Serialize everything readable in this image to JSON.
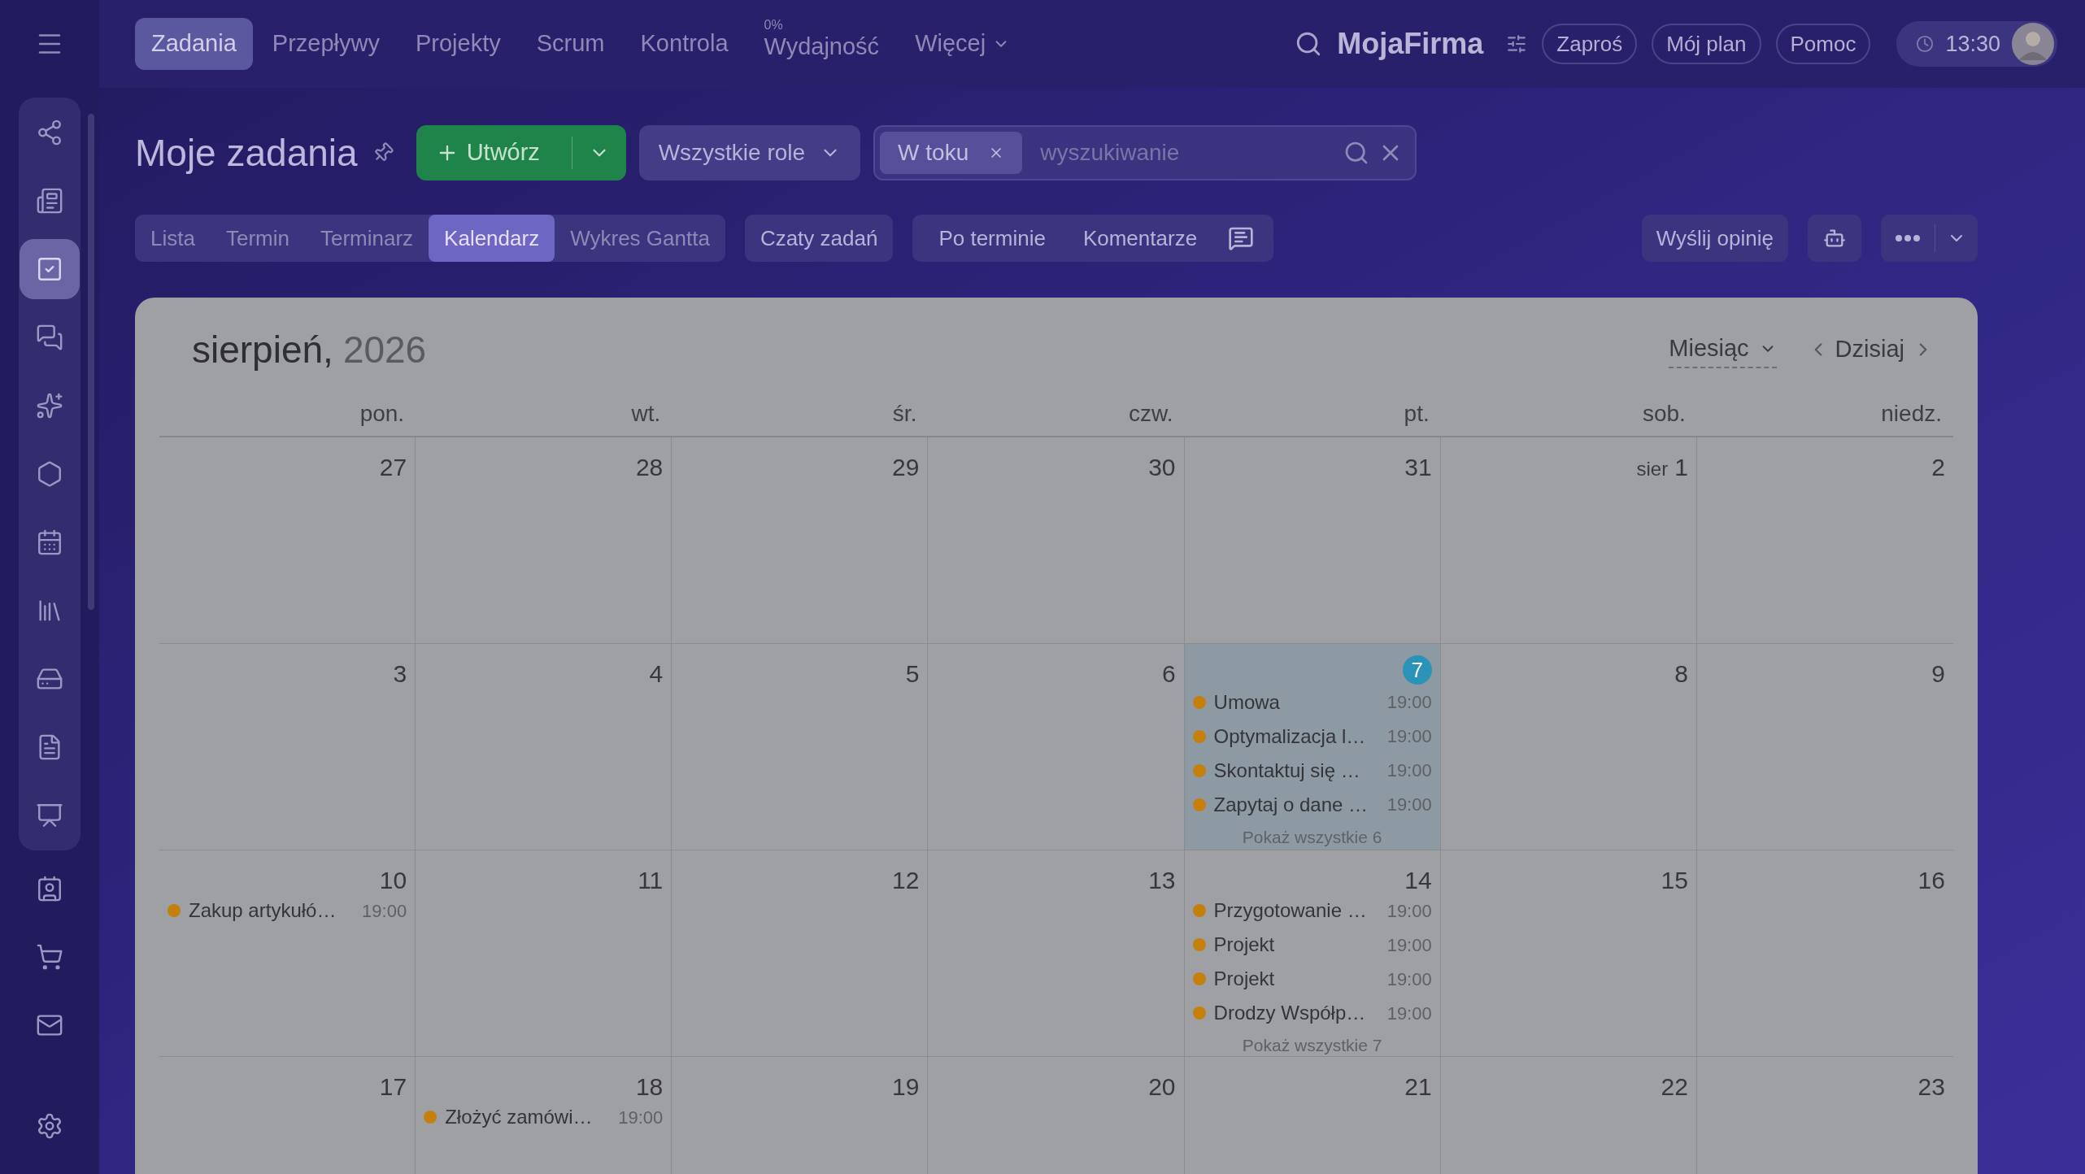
{
  "top_nav": {
    "tabs": [
      {
        "label": "Zadania",
        "selected": true,
        "kind": "link"
      },
      {
        "label": "Przepływy",
        "selected": false,
        "kind": "link"
      },
      {
        "label": "Projekty",
        "selected": false,
        "kind": "link"
      },
      {
        "label": "Scrum",
        "selected": false,
        "kind": "link"
      },
      {
        "label": "Kontrola",
        "selected": false,
        "kind": "link"
      },
      {
        "label": "Wydajność",
        "selected": false,
        "kind": "link",
        "badge": "0%"
      },
      {
        "label": "Więcej",
        "selected": false,
        "kind": "menu"
      }
    ],
    "brand": "MojaFirma",
    "buttons": [
      "Zaproś",
      "Mój plan",
      "Pomoc"
    ],
    "clock": "13:30"
  },
  "sidebar": {
    "pinned_items": [
      {
        "kind": "nodes",
        "selected": false
      },
      {
        "kind": "news",
        "selected": false
      },
      {
        "kind": "tasks",
        "selected": true
      },
      {
        "kind": "chat",
        "selected": false
      },
      {
        "kind": "sparkle",
        "selected": false
      },
      {
        "kind": "hexagon",
        "selected": false
      },
      {
        "kind": "calendar",
        "selected": false
      },
      {
        "kind": "library",
        "selected": false
      },
      {
        "kind": "drive",
        "selected": false
      },
      {
        "kind": "document",
        "selected": false
      },
      {
        "kind": "presentation",
        "selected": false
      }
    ],
    "items": [
      {
        "kind": "contact",
        "selected": false
      },
      {
        "kind": "cart",
        "selected": false
      },
      {
        "kind": "mail",
        "selected": false
      },
      {
        "kind": "settings",
        "selected": false
      }
    ]
  },
  "header": {
    "title": "Moje zadania",
    "create_button": "Utwórz",
    "roles_dropdown": "Wszystkie role",
    "filter_chip": "W toku",
    "search": {
      "placeholder": "wyszukiwanie"
    }
  },
  "view_tabs": [
    {
      "label": "Lista",
      "selected": false
    },
    {
      "label": "Termin",
      "selected": false
    },
    {
      "label": "Terminarz",
      "selected": false
    },
    {
      "label": "Kalendarz",
      "selected": true
    },
    {
      "label": "Wykres Gantta",
      "selected": false
    }
  ],
  "chats_button": "Czaty zadań",
  "filters": [
    "Po terminie",
    "Komentarze"
  ],
  "feedback_button": "Wyślij opinię",
  "calendar": {
    "month": "sierpień,",
    "year": "2026",
    "view": "Miesiąc",
    "today_button": "Dzisiaj",
    "weekdays": [
      "pon.",
      "wt.",
      "śr.",
      "czw.",
      "pt.",
      "sob.",
      "niedz."
    ],
    "weeks": [
      [
        {
          "day": "27",
          "today": false
        },
        {
          "day": "28",
          "today": false
        },
        {
          "day": "29",
          "today": false
        },
        {
          "day": "30",
          "today": false
        },
        {
          "day": "31",
          "today": false
        },
        {
          "day": "1",
          "month_prefix": "sier",
          "today": false
        },
        {
          "day": "2",
          "today": false
        }
      ],
      [
        {
          "day": "3",
          "today": false
        },
        {
          "day": "4",
          "today": false
        },
        {
          "day": "5",
          "today": false
        },
        {
          "day": "6",
          "today": false
        },
        {
          "day": "7",
          "today": true,
          "events": [
            {
              "title": "Umowa",
              "time": "19:00"
            },
            {
              "title": "Optymalizacja l…",
              "time": "19:00"
            },
            {
              "title": "Skontaktuj się …",
              "time": "19:00"
            },
            {
              "title": "Zapytaj o dane …",
              "time": "19:00"
            }
          ],
          "more": "Pokaż wszystkie 6"
        },
        {
          "day": "8",
          "today": false
        },
        {
          "day": "9",
          "today": false
        }
      ],
      [
        {
          "day": "10",
          "today": false,
          "events": [
            {
              "title": "Zakup artykułó…",
              "time": "19:00"
            }
          ]
        },
        {
          "day": "11",
          "today": false
        },
        {
          "day": "12",
          "today": false
        },
        {
          "day": "13",
          "today": false
        },
        {
          "day": "14",
          "today": false,
          "events": [
            {
              "title": "Przygotowanie …",
              "time": "19:00"
            },
            {
              "title": "Projekt",
              "time": "19:00"
            },
            {
              "title": "Projekt",
              "time": "19:00"
            },
            {
              "title": "Drodzy Współp…",
              "time": "19:00"
            }
          ],
          "more": "Pokaż wszystkie 7"
        },
        {
          "day": "15",
          "today": false
        },
        {
          "day": "16",
          "today": false
        }
      ],
      [
        {
          "day": "17",
          "today": false
        },
        {
          "day": "18",
          "today": false,
          "events": [
            {
              "title": "Złożyć zamówi…",
              "time": "19:00"
            }
          ]
        },
        {
          "day": "19",
          "today": false
        },
        {
          "day": "20",
          "today": false
        },
        {
          "day": "21",
          "today": false
        },
        {
          "day": "22",
          "today": false
        },
        {
          "day": "23",
          "today": false
        }
      ]
    ]
  }
}
